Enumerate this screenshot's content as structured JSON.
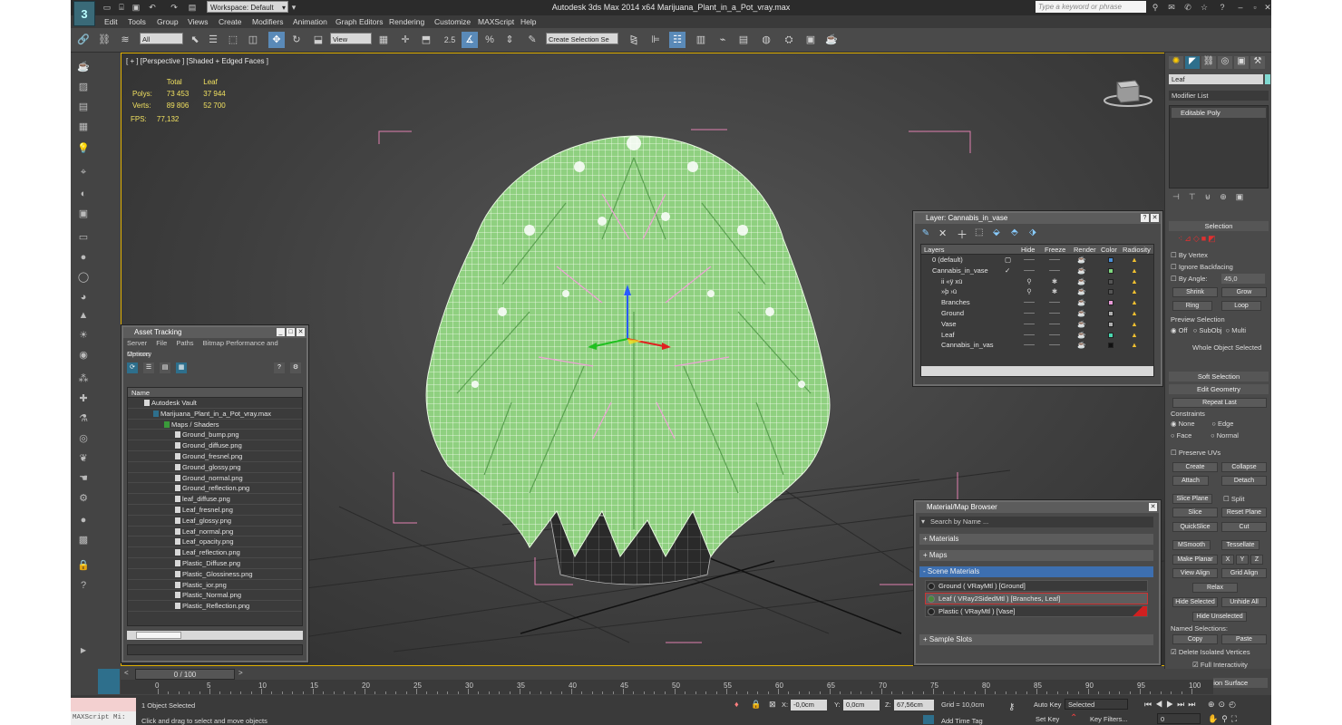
{
  "app": {
    "logo": "3",
    "title": "Autodesk 3ds Max  2014 x64     Marijuana_Plant_in_a_Pot_vray.max",
    "workspace": "Workspace: Default",
    "search_placeholder": "Type a keyword or phrase"
  },
  "menu": [
    "Edit",
    "Tools",
    "Group",
    "Views",
    "Create",
    "Modifiers",
    "Animation",
    "Graph Editors",
    "Rendering",
    "Customize",
    "MAXScript",
    "Help"
  ],
  "toolbar": {
    "filter": "All",
    "coord": "View",
    "selection_set": "Create Selection Se",
    "snap_label": "2.5",
    "percent_label": "%"
  },
  "viewport": {
    "label": "[ + ] [Perspective ] [Shaded + Edged Faces ]",
    "stats": {
      "col_total": "Total",
      "col_leaf": "Leaf",
      "polys_label": "Polys:",
      "polys_total": "73 453",
      "polys_leaf": "37 944",
      "verts_label": "Verts:",
      "verts_total": "89 806",
      "verts_leaf": "52 700",
      "fps_label": "FPS:",
      "fps_value": "77,132"
    }
  },
  "asset_tracking": {
    "title": "Asset Tracking",
    "menu": [
      "Server",
      "File",
      "Paths",
      "Bitmap Performance and Memory"
    ],
    "menu2": "Options",
    "column": "Name",
    "vault": "Autodesk Vault",
    "file": "Marijuana_Plant_in_a_Pot_vray.max",
    "folder": "Maps / Shaders",
    "maps": [
      "Ground_bump.png",
      "Ground_diffuse.png",
      "Ground_fresnel.png",
      "Ground_glossy.png",
      "Ground_normal.png",
      "Ground_reflection.png",
      "leaf_diffuse.png",
      "Leaf_fresnel.png",
      "Leaf_glossy.png",
      "Leaf_normal.png",
      "Leaf_opacity.png",
      "Leaf_reflection.png",
      "Plastic_Diffuse.png",
      "Plastic_Glossiness.png",
      "Plastic_ior.png",
      "Plastic_Normal.png",
      "Plastic_Reflection.png"
    ]
  },
  "layers": {
    "title": "Layer: Cannabis_in_vase",
    "columns": [
      "Layers",
      "Hide",
      "Freeze",
      "Render",
      "Color",
      "Radiosity"
    ],
    "rows": [
      {
        "name": "0 (default)",
        "color": "#4a8fd8",
        "indent": 0
      },
      {
        "name": "Cannabis_in_vase",
        "color": "#7fd87f",
        "indent": 0
      },
      {
        "name": "ii «ÿ xü",
        "color": "#555555",
        "indent": 2
      },
      {
        "name": "»þ ›ü",
        "color": "#555555",
        "indent": 2
      },
      {
        "name": "Branches",
        "color": "#e89ad8",
        "indent": 2
      },
      {
        "name": "Ground",
        "color": "#b0b0b0",
        "indent": 2
      },
      {
        "name": "Vase",
        "color": "#b0b0b0",
        "indent": 2
      },
      {
        "name": "Leaf",
        "color": "#4ad8b0",
        "indent": 2
      },
      {
        "name": "Cannabis_in_vas",
        "color": "#111111",
        "indent": 2
      }
    ]
  },
  "material_browser": {
    "title": "Material/Map Browser",
    "search": "Search by Name ...",
    "groups": [
      "+ Materials",
      "+ Maps",
      "- Scene Materials",
      "+ Sample Slots"
    ],
    "materials": [
      "Ground  ( VRayMtl )  [Ground]",
      "Leaf  ( VRay2SidedMtl )  [Branches, Leaf]",
      "Plastic  ( VRayMtl )  [Vase]"
    ]
  },
  "command_panel": {
    "object_name": "Leaf",
    "modifier_list": "Modifier List",
    "stack_item": "Editable Poly",
    "selection_header": "Selection",
    "by_vertex": "By Vertex",
    "ignore_backfacing": "Ignore Backfacing",
    "by_angle": "By Angle:",
    "angle_value": "45,0",
    "shrink": "Shrink",
    "grow": "Grow",
    "ring": "Ring",
    "loop": "Loop",
    "preview_selection": "Preview Selection",
    "off": "Off",
    "subobj": "SubObj",
    "multi": "Multi",
    "whole_object": "Whole Object Selected",
    "soft_selection": "Soft Selection",
    "edit_geometry": "Edit Geometry",
    "repeat_last": "Repeat Last",
    "constraints": "Constraints",
    "none": "None",
    "edge": "Edge",
    "face": "Face",
    "normal": "Normal",
    "preserve_uvs": "Preserve UVs",
    "create": "Create",
    "collapse": "Collapse",
    "attach": "Attach",
    "detach": "Detach",
    "slice_plane": "Slice Plane",
    "split": "Split",
    "slice": "Slice",
    "reset_plane": "Reset Plane",
    "quickslice": "QuickSlice",
    "cut": "Cut",
    "msmooth": "MSmooth",
    "tessellate": "Tessellate",
    "make_planar": "Make Planar",
    "x": "X",
    "y": "Y",
    "z": "Z",
    "view_align": "View Align",
    "grid_align": "Grid Align",
    "relax": "Relax",
    "hide_selected": "Hide Selected",
    "unhide_all": "Unhide All",
    "hide_unselected": "Hide Unselected",
    "named_selections": "Named Selections:",
    "copy": "Copy",
    "paste": "Paste",
    "delete_isolated": "Delete Isolated Vertices",
    "full_interactivity": "Full Interactivity",
    "subdivision_surface": "Subdivision Surface"
  },
  "timeline": {
    "frame": "0 / 100",
    "ticks": [
      "0",
      "5",
      "10",
      "15",
      "20",
      "25",
      "30",
      "35",
      "40",
      "45",
      "50",
      "55",
      "60",
      "65",
      "70",
      "75",
      "80",
      "85",
      "90",
      "95",
      "100"
    ]
  },
  "status": {
    "maxscript": "MAXScript Mi:",
    "objects_selected": "1 Object Selected",
    "prompt": "Click and drag to select and move objects",
    "x_label": "X:",
    "x_value": "-0,0cm",
    "y_label": "Y:",
    "y_value": "0,0cm",
    "z_label": "Z:",
    "z_value": "67,56cm",
    "grid": "Grid = 10,0cm",
    "add_time_tag": "Add Time Tag",
    "auto_key": "Auto Key",
    "set_key": "Set Key",
    "key_mode": "Selected",
    "key_filters": "Key Filters...",
    "frame_value": "0"
  }
}
